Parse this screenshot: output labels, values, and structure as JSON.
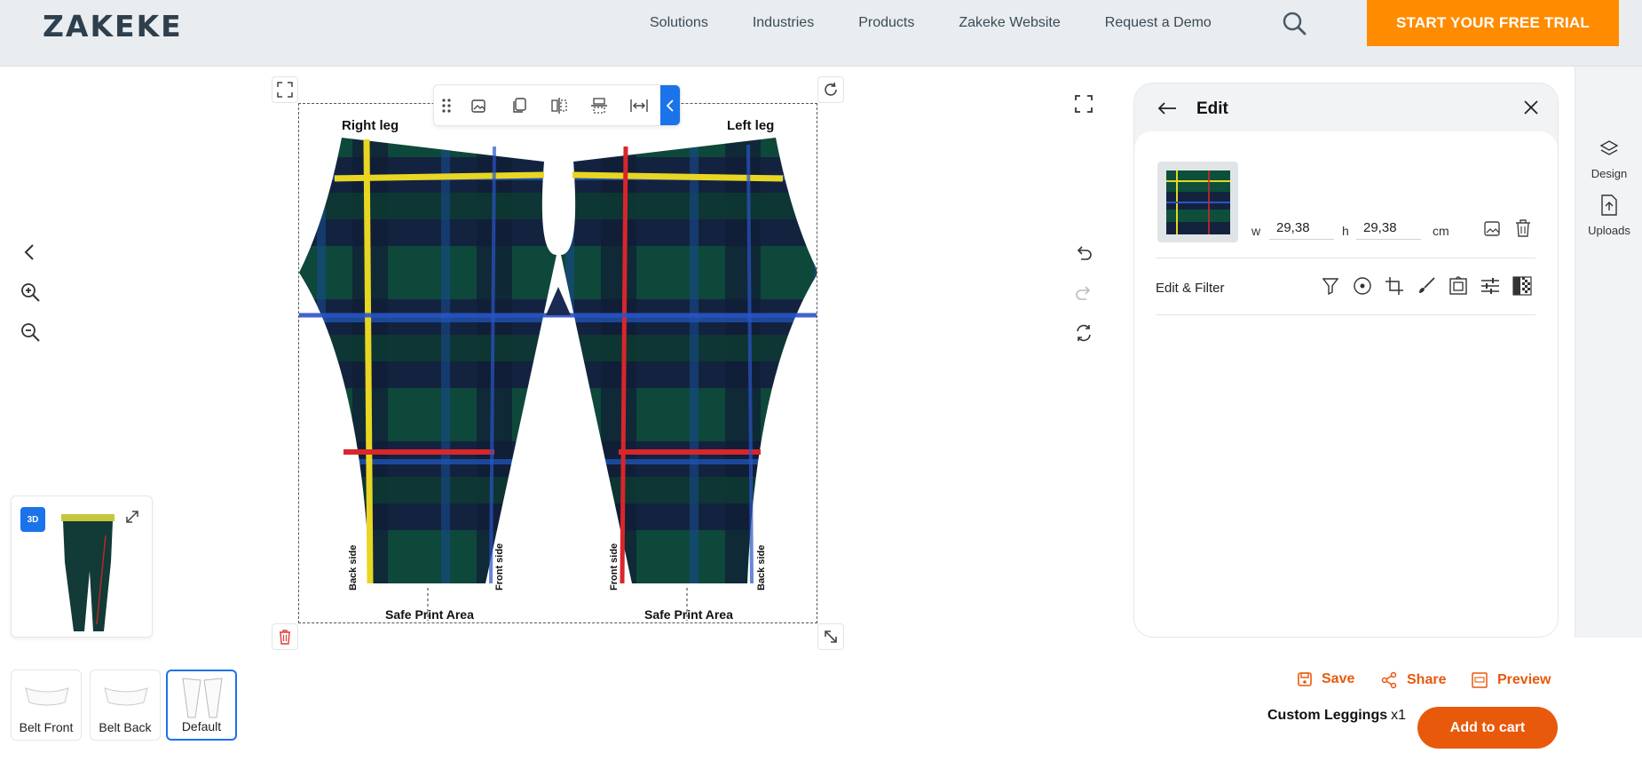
{
  "brand": {
    "logo_text": "ZAKEKE"
  },
  "nav": {
    "items": [
      "Solutions",
      "Industries",
      "Products",
      "Zakeke Website",
      "Request a Demo"
    ],
    "cta": "START YOUR FREE TRIAL"
  },
  "canvas": {
    "right_leg": "Right leg",
    "left_leg": "Left leg",
    "side_labels": [
      "Back side",
      "Front side",
      "Front side",
      "Back side"
    ],
    "safe_area": [
      "Safe Print Area",
      "Safe Print Area"
    ]
  },
  "preview3d": {
    "badge": "3D"
  },
  "sides": [
    {
      "label": "Belt Front"
    },
    {
      "label": "Belt Back"
    },
    {
      "label": "Default"
    }
  ],
  "edit": {
    "title": "Edit",
    "w_label": "w",
    "w_value": "29,38",
    "h_label": "h",
    "h_value": "29,38",
    "unit": "cm",
    "filter_label": "Edit & Filter"
  },
  "right_sidebar": {
    "design": "Design",
    "uploads": "Uploads"
  },
  "actions": {
    "save": "Save",
    "share": "Share",
    "preview": "Preview"
  },
  "product": {
    "name": "Custom Leggings",
    "qty": "x1",
    "add_to_cart": "Add to cart"
  },
  "colors": {
    "accent_orange": "#ff8c00",
    "action_orange": "#e8590c",
    "blue": "#1a73e8",
    "tartan_green": "#0f5a3c",
    "tartan_navy": "#142046"
  }
}
